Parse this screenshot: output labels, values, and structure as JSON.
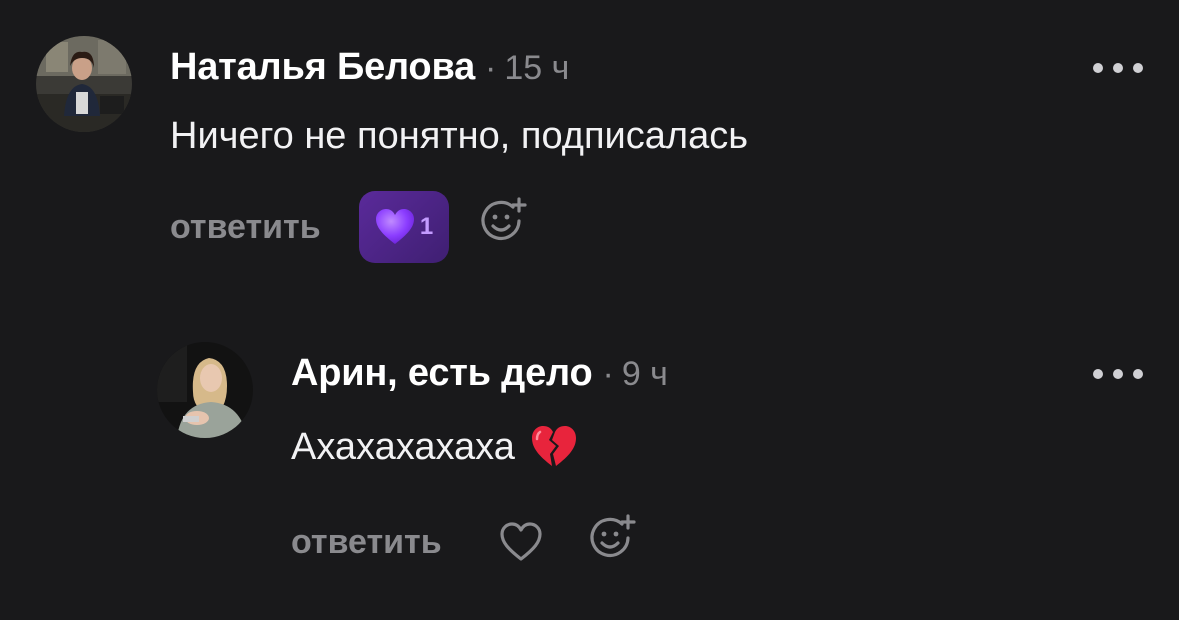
{
  "comments": [
    {
      "author": "Наталья Белова",
      "separator": "·",
      "time": "15 ч",
      "text": "Ничего не понятно, подписалась",
      "reply_label": "ответить",
      "reaction": {
        "icon": "purple-heart-icon",
        "count": "1",
        "color": "#8b3dff"
      },
      "avatar": "woman-in-office-avatar"
    },
    {
      "author": "Арин, есть дело",
      "separator": "·",
      "time": "9 ч",
      "text": "Ахахахахаха",
      "emoji": "broken-heart-icon",
      "reply_label": "ответить",
      "avatar": "blonde-woman-avatar"
    }
  ],
  "colors": {
    "background": "#19191b",
    "muted": "#8a8a8e",
    "accent": "#8b3dff"
  }
}
